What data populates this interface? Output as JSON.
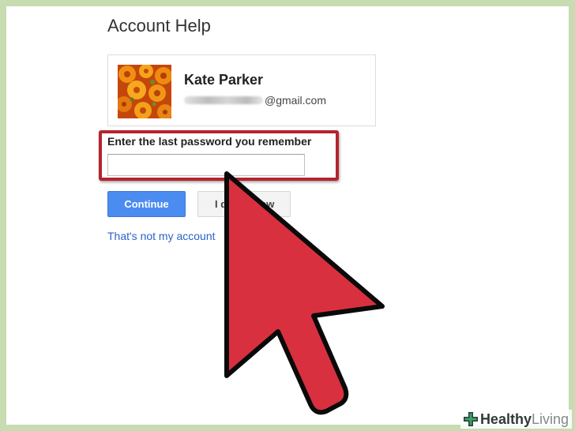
{
  "page": {
    "title": "Account Help"
  },
  "account": {
    "name": "Kate Parker",
    "email_suffix": "@gmail.com",
    "avatar_icon": "orange-flowers-photo"
  },
  "password_prompt": {
    "label": "Enter the last password you remember",
    "value": "",
    "highlight_color": "#b4242e"
  },
  "actions": {
    "continue_label": "Continue",
    "dont_know_label": "I don't know",
    "not_my_account_link": "That's not my account"
  },
  "overlay": {
    "pointer_icon": "cursor-arrow-icon",
    "pointer_color": "#d93040"
  },
  "watermark": {
    "brand_bold": "Healthy",
    "brand_light": "Living",
    "logo_icon": "plus-cross-icon"
  },
  "colors": {
    "accent_blue": "#4a8cf0",
    "link_blue": "#2a63c9",
    "frame_green": "#c7dcb1"
  }
}
